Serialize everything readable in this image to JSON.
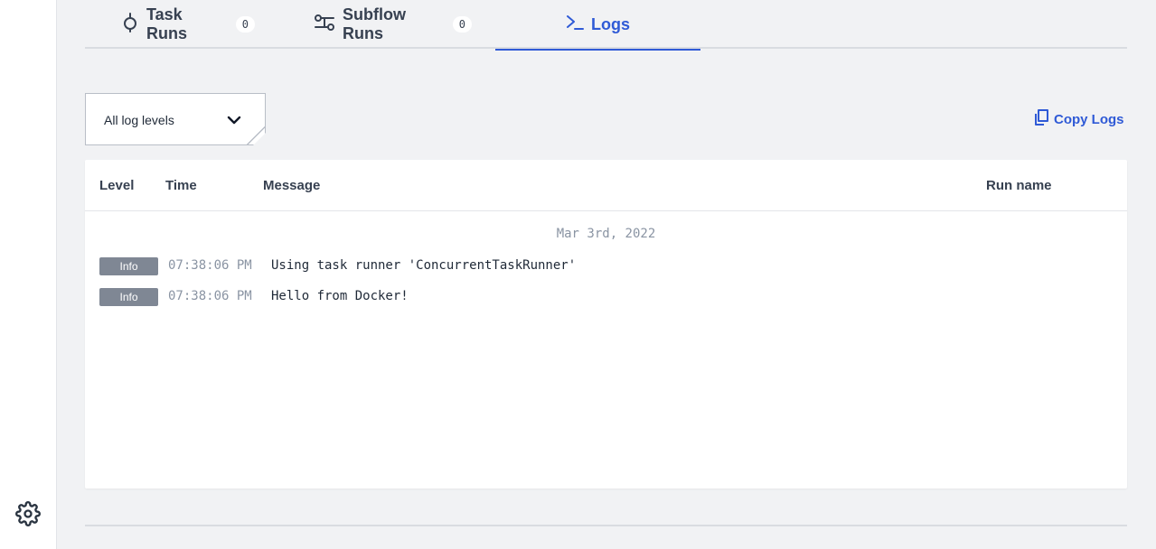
{
  "tabs": [
    {
      "label": "Task Runs",
      "count": "0",
      "icon": "task-run-icon"
    },
    {
      "label": "Subflow Runs",
      "count": "0",
      "icon": "subflow-icon"
    },
    {
      "label": "Logs",
      "icon": "terminal-icon",
      "active": true
    }
  ],
  "filter": {
    "selected": "All log levels"
  },
  "copy_logs_label": "Copy Logs",
  "table": {
    "headers": {
      "level": "Level",
      "time": "Time",
      "message": "Message",
      "run_name": "Run name"
    },
    "date": "Mar 3rd, 2022",
    "rows": [
      {
        "level": "Info",
        "time": "07:38:06 PM",
        "message": "Using task runner 'ConcurrentTaskRunner'"
      },
      {
        "level": "Info",
        "time": "07:38:06 PM",
        "message": "Hello from Docker!"
      }
    ]
  },
  "colors": {
    "accent": "#2f5ad6",
    "badge": "#7f8794",
    "background": "#f1f2f4"
  }
}
